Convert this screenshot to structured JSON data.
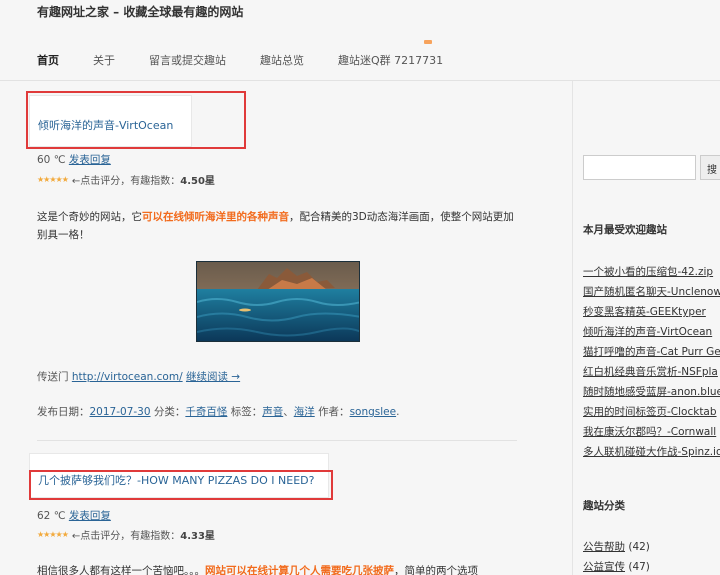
{
  "site": {
    "title": "有趣网址之家 – 收藏全球最有趣的网站"
  },
  "nav": {
    "items": [
      "首页",
      "关于",
      "留言或提交趣站",
      "趣站总览",
      "趣站迷Q群 7217731"
    ]
  },
  "post1": {
    "title": "倾听海洋的声音-VirtOcean",
    "temp": "60 ℃",
    "reply": "发表回复",
    "rating_prompt": "←点击评分，有趣指数：",
    "rating": "4.50星",
    "text_a": "这是个奇妙的网站，它",
    "text_hl": "可以在线倾听海洋里的各种声音",
    "text_b": "，配合精美的3D动态海洋画面，使整个网站更加别具一格！",
    "portal_label": "传送门",
    "portal_url": "http://virtocean.com/",
    "read_more": "继续阅读 →",
    "date_label": "发布日期：",
    "date": "2017-07-30",
    "cat_label": "分类：",
    "category": "千奇百怪",
    "tag_label": "标签：",
    "tag1": "声音",
    "tag_sep": "、",
    "tag2": "海洋",
    "author_label": "作者：",
    "author": "songslee",
    "end": "."
  },
  "post2": {
    "title": "几个披萨够我们吃？-HOW MANY PIZZAS DO I NEED?",
    "temp": "62 ℃",
    "reply": "发表回复",
    "rating_prompt": "←点击评分，有趣指数：",
    "rating": "4.33星",
    "text_a": "相信很多人都有这样一个苦恼吧。。。",
    "text_hl": "网站可以在线计算几个人需要吃几张披萨",
    "text_b": "，简单的两个选项"
  },
  "sidebar": {
    "search_button": "搜",
    "popular_heading": "本月最受欢迎趣站",
    "popular": [
      "一个被小看的压缩包-42.zip",
      "国产随机匿名聊天-Unclenow",
      "秒变黑客精英-GEEKtyper",
      "倾听海洋的声音-VirtOcean",
      "猫打呼噜的声音-Cat Purr Ge",
      "红白机经典音乐赏析-NSFpla",
      "随时随地感受蓝屏-anon.blue",
      "实用的时间标签页-Clocktab",
      "我在康沃尔郡吗？-Cornwall",
      "多人联机碰碰大作战-Spinz.io"
    ],
    "cat_heading": "趣站分类",
    "categories": [
      {
        "name": "公告帮助",
        "count": "(42)"
      },
      {
        "name": "公益宣传",
        "count": "(47)"
      }
    ]
  }
}
